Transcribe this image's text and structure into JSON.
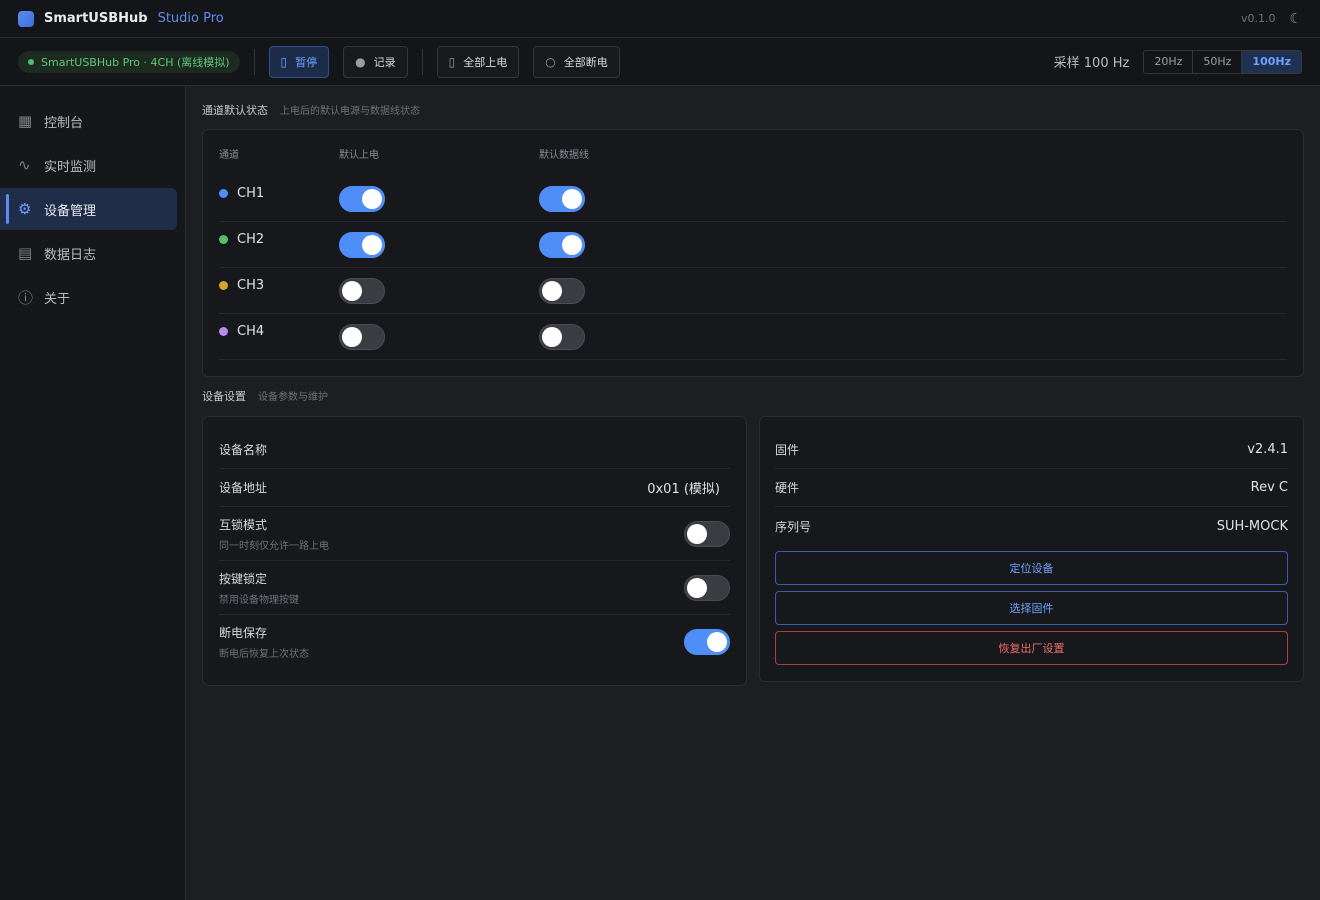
{
  "titlebar": {
    "app_name": "SmartUSBHub",
    "edition": "Studio Pro",
    "version": "v0.1.0",
    "theme_icon": "moon-icon"
  },
  "toolbar": {
    "connection": "SmartUSBHub Pro · 4CH (离线模拟)",
    "pause_label": "暂停",
    "record_label": "记录",
    "power_all_on_label": "全部上电",
    "power_all_off_label": "全部断电",
    "sample_label": "采样 100 Hz",
    "rates": [
      "20Hz",
      "50Hz",
      "100Hz"
    ],
    "active_rate": "100Hz"
  },
  "sidebar": {
    "items": [
      {
        "label": "控制台",
        "icon": "grid-icon"
      },
      {
        "label": "实时监测",
        "icon": "wave-icon"
      },
      {
        "label": "设备管理",
        "icon": "gear-icon",
        "active": true
      },
      {
        "label": "数据日志",
        "icon": "log-icon"
      },
      {
        "label": "关于",
        "icon": "info-icon"
      }
    ]
  },
  "channel_defaults": {
    "title": "通道默认状态",
    "subtitle": "上电后的默认电源与数据线状态",
    "headers": [
      "通道",
      "默认上电",
      "默认数据线"
    ],
    "channels": [
      {
        "name": "CH1",
        "color": "#4f8ef7",
        "power": true,
        "data": true
      },
      {
        "name": "CH2",
        "color": "#4fc06e",
        "power": true,
        "data": true
      },
      {
        "name": "CH3",
        "color": "#d4a52a",
        "power": false,
        "data": false
      },
      {
        "name": "CH4",
        "color": "#b58cf0",
        "power": false,
        "data": false
      }
    ]
  },
  "device_settings": {
    "title": "设备设置",
    "subtitle": "设备参数与维护",
    "name_label": "设备名称",
    "address_label": "设备地址",
    "address_value": "0x01 (模拟)",
    "interlock_label": "互锁模式",
    "interlock_desc": "同一时刻仅允许一路上电",
    "interlock_on": false,
    "keylock_label": "按键锁定",
    "keylock_desc": "禁用设备物理按键",
    "keylock_on": false,
    "powersave_label": "断电保存",
    "powersave_desc": "断电后恢复上次状态",
    "powersave_on": true
  },
  "device_info": {
    "firmware_label": "固件",
    "firmware_value": "v2.4.1",
    "hardware_label": "硬件",
    "hardware_value": "Rev C",
    "serial_label": "序列号",
    "serial_value": "SUH-MOCK",
    "locate_label": "定位设备",
    "select_fw_label": "选择固件",
    "factory_reset_label": "恢复出厂设置"
  }
}
